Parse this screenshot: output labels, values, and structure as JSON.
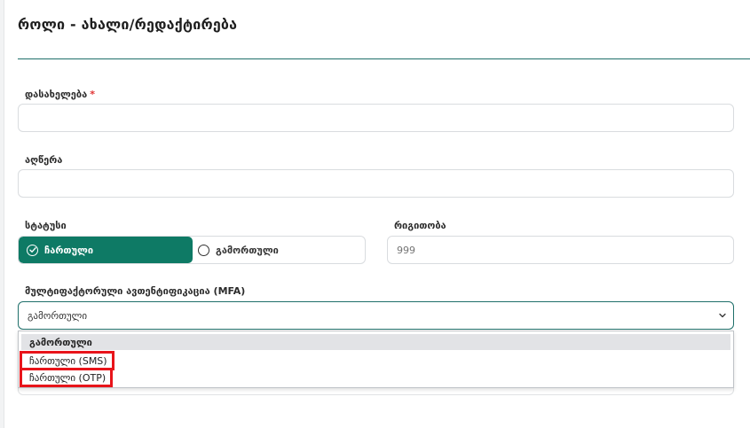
{
  "page": {
    "title": "როლი - ახალი/რედაქტირება"
  },
  "form": {
    "name": {
      "label": "დასახელება",
      "required_mark": "*",
      "value": ""
    },
    "description": {
      "label": "აღწერა",
      "value": ""
    },
    "status": {
      "label": "სტატუსი",
      "options": [
        {
          "label": "ჩართული",
          "selected": true
        },
        {
          "label": "გამორთული",
          "selected": false
        }
      ]
    },
    "order": {
      "label": "რიგითობა",
      "placeholder": "999"
    },
    "mfa": {
      "label": "მულტიფაქტორული ავთენტიფიკაცია (MFA)",
      "selected": "გამორთული",
      "options": [
        {
          "label": "გამორთული",
          "selected": true
        },
        {
          "label": "ჩართული (SMS)",
          "selected": false
        },
        {
          "label": "ჩართული (OTP)",
          "selected": false
        }
      ]
    }
  },
  "colors": {
    "accent": "#0e7a65",
    "divider": "#1f6f6a",
    "required": "#e03131",
    "highlight_box": "#e8141a"
  },
  "icons": {
    "status_on": "check-circle-icon",
    "status_off": "radio-empty-icon",
    "select": "chevron-down-icon"
  }
}
